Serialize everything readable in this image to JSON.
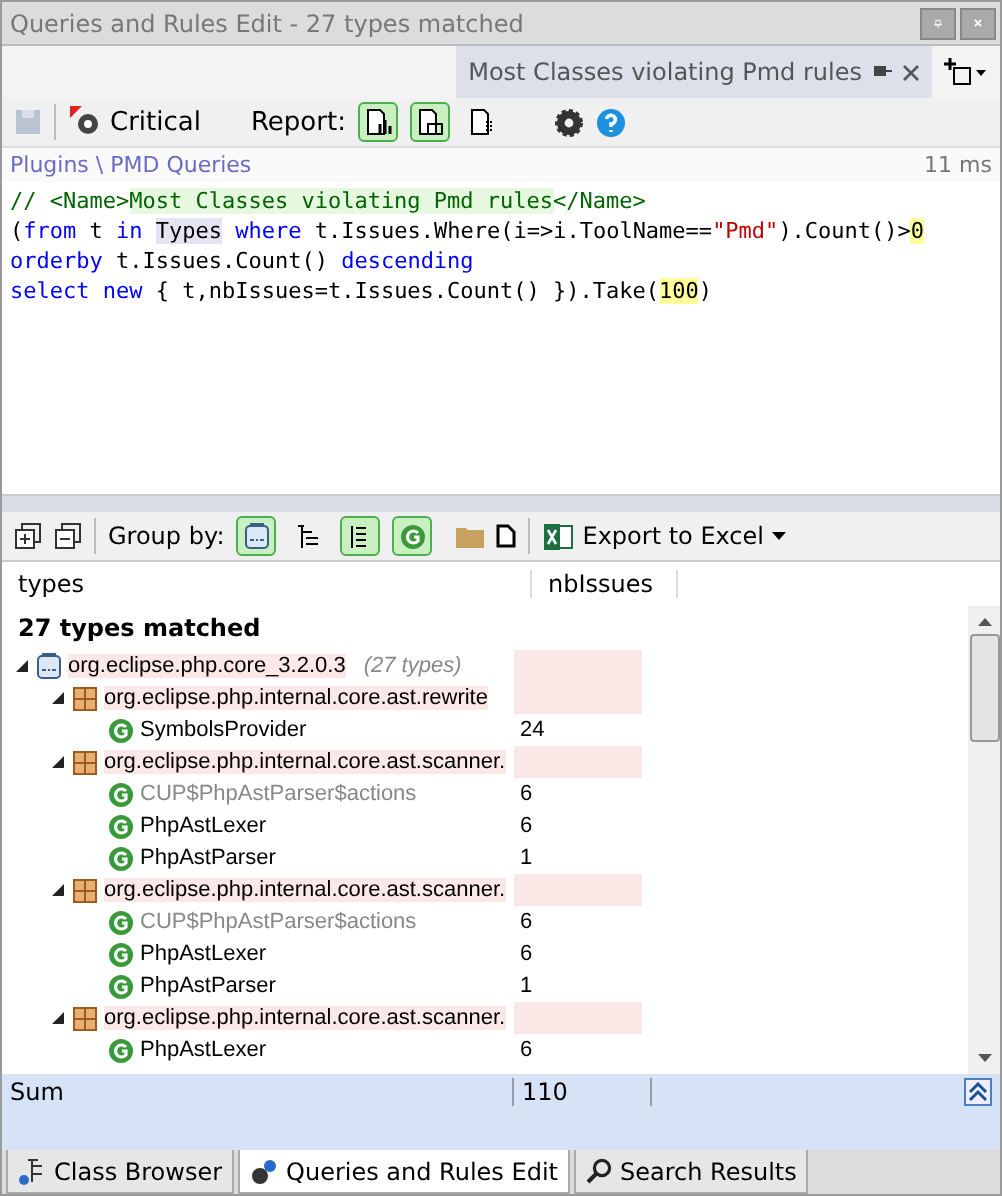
{
  "window": {
    "title": "Queries and Rules Edit  - 27 types matched"
  },
  "doc_tab": {
    "label": "Most Classes violating Pmd rules"
  },
  "toolbar": {
    "severity": "Critical",
    "report_label": "Report:"
  },
  "breadcrumb": {
    "path": "Plugins \\ PMD Queries",
    "time": "11 ms"
  },
  "code": [
    [
      {
        "kind": "comment",
        "text": "// <Name>"
      },
      {
        "kind": "comment-mark",
        "text": "Most Classes violating Pmd rules"
      },
      {
        "kind": "comment",
        "text": "</Name>"
      }
    ],
    [
      {
        "kind": "plain",
        "text": "("
      },
      {
        "kind": "keyword",
        "text": "from"
      },
      {
        "kind": "plain",
        "text": " t "
      },
      {
        "kind": "keyword",
        "text": "in "
      },
      {
        "kind": "ident-mark",
        "text": "Types"
      },
      {
        "kind": "keyword",
        "text": " where"
      },
      {
        "kind": "plain",
        "text": " t.Issues.Where(i=>i.ToolName=="
      },
      {
        "kind": "string",
        "text": "\"Pmd\""
      },
      {
        "kind": "plain",
        "text": ").Count()>"
      },
      {
        "kind": "number-mark",
        "text": "0"
      }
    ],
    [
      {
        "kind": "keyword",
        "text": "orderby"
      },
      {
        "kind": "plain",
        "text": " t.Issues.Count() "
      },
      {
        "kind": "keyword",
        "text": "descending"
      }
    ],
    [
      {
        "kind": "keyword",
        "text": "select new"
      },
      {
        "kind": "plain",
        "text": " { t,nbIssues=t.Issues.Count() }).Take("
      },
      {
        "kind": "number-mark",
        "text": "100"
      },
      {
        "kind": "plain",
        "text": ")"
      }
    ]
  ],
  "results_toolbar": {
    "group_by_label": "Group by:",
    "export_label": "Export to Excel"
  },
  "table": {
    "columns": [
      "types",
      "nbIssues"
    ],
    "summary": "27 types matched",
    "rows": [
      {
        "kind": "assembly",
        "name": "org.eclipse.php.core_3.2.0.3",
        "note": "(27 types)",
        "expanded": true,
        "children": [
          {
            "kind": "namespace",
            "name": "org.eclipse.php.internal.core.ast.rewrite",
            "expanded": true,
            "children": [
              {
                "kind": "type",
                "name": "SymbolsProvider",
                "value": "24",
                "dimmed": false
              }
            ]
          },
          {
            "kind": "namespace",
            "name": "org.eclipse.php.internal.core.ast.scanner.",
            "expanded": true,
            "children": [
              {
                "kind": "type",
                "name": "CUP$PhpAstParser$actions",
                "value": "6",
                "dimmed": true
              },
              {
                "kind": "type",
                "name": "PhpAstLexer",
                "value": "6",
                "dimmed": false
              },
              {
                "kind": "type",
                "name": "PhpAstParser",
                "value": "1",
                "dimmed": false
              }
            ]
          },
          {
            "kind": "namespace",
            "name": "org.eclipse.php.internal.core.ast.scanner.",
            "expanded": true,
            "children": [
              {
                "kind": "type",
                "name": "CUP$PhpAstParser$actions",
                "value": "6",
                "dimmed": true
              },
              {
                "kind": "type",
                "name": "PhpAstLexer",
                "value": "6",
                "dimmed": false
              },
              {
                "kind": "type",
                "name": "PhpAstParser",
                "value": "1",
                "dimmed": false
              }
            ]
          },
          {
            "kind": "namespace",
            "name": "org.eclipse.php.internal.core.ast.scanner.",
            "expanded": true,
            "children": [
              {
                "kind": "type",
                "name": "PhpAstLexer",
                "value": "6",
                "dimmed": false
              }
            ]
          }
        ]
      }
    ],
    "sum_label": "Sum",
    "sum_value": "110"
  },
  "bottom_tabs": [
    {
      "label": "Class Browser",
      "selected": false
    },
    {
      "label": "Queries and Rules Edit",
      "selected": true
    },
    {
      "label": "Search Results",
      "selected": false
    }
  ]
}
